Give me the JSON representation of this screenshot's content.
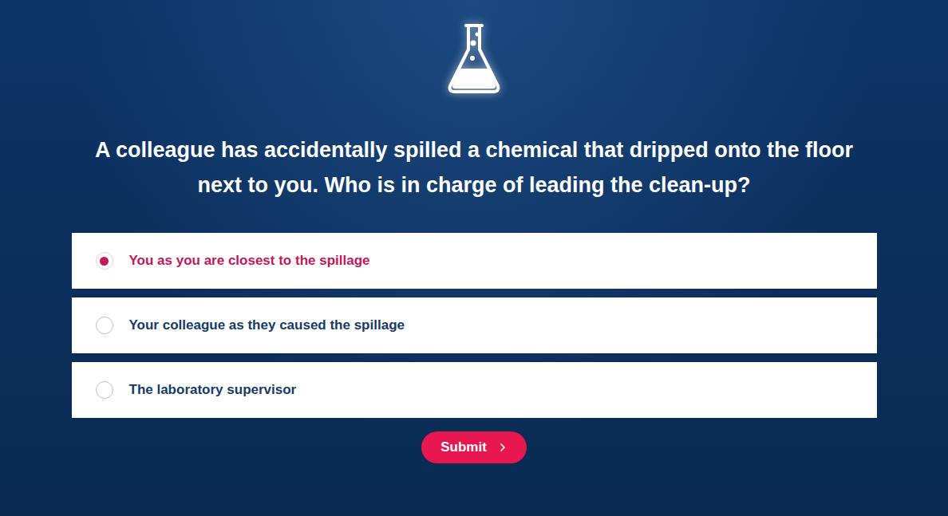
{
  "quiz": {
    "question": "A colleague has accidentally spilled a chemical that dripped onto the floor next to you. Who is in charge of leading the clean-up?",
    "options": [
      {
        "label": "You as you are closest to the spillage",
        "selected": true
      },
      {
        "label": "Your colleague as they caused the spillage",
        "selected": false
      },
      {
        "label": "The laboratory supervisor",
        "selected": false
      }
    ],
    "submit": {
      "label": "Submit"
    }
  }
}
